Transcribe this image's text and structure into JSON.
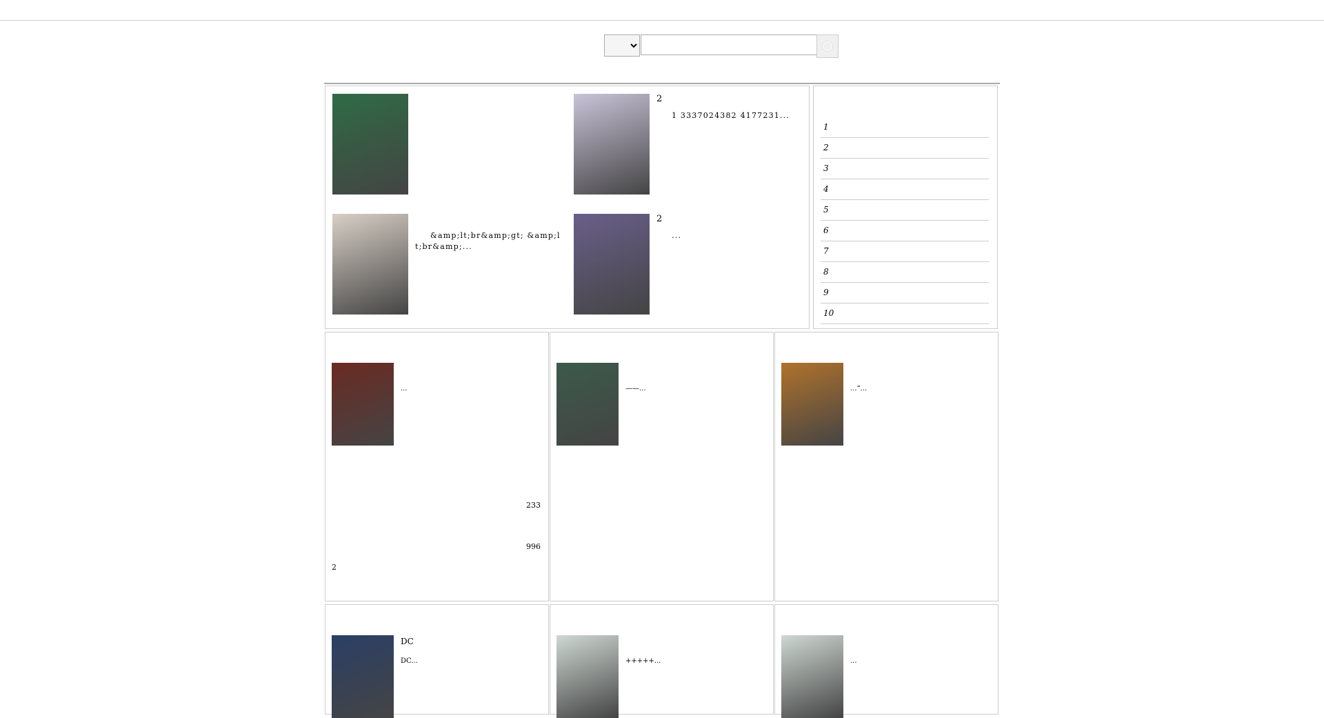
{
  "topbar": {
    "left": [
      "",
      ""
    ],
    "right": [
      "",
      ""
    ]
  },
  "logo": "",
  "search": {
    "options": [
      ""
    ],
    "value": ""
  },
  "nav": [
    "",
    "",
    "",
    "",
    "",
    "",
    "",
    "",
    "",
    ""
  ],
  "featured": [
    {
      "title": "",
      "desc": "",
      "cover_color": "#2f6b45"
    },
    {
      "title": "2",
      "desc": "1 3337024382 4177231...",
      "cover_color": "#c9c3d8"
    },
    {
      "title": "",
      "desc": "&amp;lt;br&amp;gt; &amp;lt;br&amp;...",
      "cover_color": "#d8cfc6"
    },
    {
      "title": "2",
      "desc": "...",
      "cover_color": "#6a5f8a"
    }
  ],
  "ranking": {
    "title": "",
    "items": [
      {
        "num": "1",
        "name": "",
        "author": ""
      },
      {
        "num": "2",
        "name": "",
        "author": ""
      },
      {
        "num": "3",
        "name": "",
        "author": ""
      },
      {
        "num": "4",
        "name": "",
        "author": ""
      },
      {
        "num": "5",
        "name": "",
        "author": ""
      },
      {
        "num": "6",
        "name": "",
        "author": ""
      },
      {
        "num": "7",
        "name": "",
        "author": ""
      },
      {
        "num": "8",
        "name": "",
        "author": ""
      },
      {
        "num": "9",
        "name": "",
        "author": ""
      },
      {
        "num": "10",
        "name": "",
        "author": ""
      }
    ]
  },
  "categories": [
    {
      "title": "",
      "book": {
        "title": "",
        "desc": "...",
        "cover_color": "#6b2a22"
      },
      "rows": [
        {
          "name": "",
          "author": ""
        },
        {
          "name": "",
          "author": ""
        },
        {
          "name": "",
          "author": "233"
        },
        {
          "name": "",
          "author": ""
        },
        {
          "name": "",
          "author": "996"
        },
        {
          "name": "2",
          "author": ""
        },
        {
          "name": "",
          "author": ""
        }
      ]
    },
    {
      "title": "",
      "book": {
        "title": "",
        "desc": "——...",
        "cover_color": "#3c5a4a"
      },
      "rows": [
        {
          "name": "",
          "author": ""
        },
        {
          "name": "",
          "author": ""
        },
        {
          "name": "",
          "author": ""
        },
        {
          "name": "",
          "author": ""
        },
        {
          "name": "",
          "author": ""
        },
        {
          "name": "",
          "author": ""
        },
        {
          "name": "",
          "author": ""
        }
      ]
    },
    {
      "title": "",
      "book": {
        "title": "",
        "desc": "...“...",
        "cover_color": "#b0722c"
      },
      "rows": [
        {
          "name": "",
          "author": ""
        },
        {
          "name": "",
          "author": ""
        },
        {
          "name": "",
          "author": ""
        },
        {
          "name": "",
          "author": ""
        },
        {
          "name": "",
          "author": ""
        },
        {
          "name": "",
          "author": ""
        },
        {
          "name": "",
          "author": ""
        }
      ]
    },
    {
      "title": "",
      "book": {
        "title": "DC",
        "desc": "DC...",
        "cover_color": "#2b3f66"
      },
      "rows": []
    },
    {
      "title": "",
      "book": {
        "title": "",
        "desc": "+++++...",
        "cover_color": "#cfd8d3"
      },
      "rows": []
    },
    {
      "title": "",
      "book": {
        "title": "",
        "desc": "...",
        "cover_color": "#cfd8d3"
      },
      "rows": []
    }
  ]
}
